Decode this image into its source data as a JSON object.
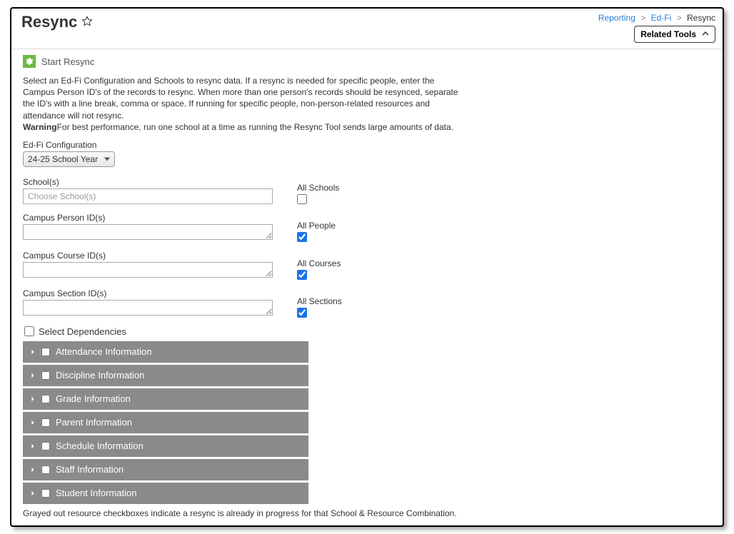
{
  "header": {
    "title": "Resync",
    "breadcrumb": {
      "reporting": "Reporting",
      "edfi": "Ed-Fi",
      "current": "Resync"
    },
    "related_tools_label": "Related Tools"
  },
  "start": {
    "label": "Start Resync"
  },
  "intro": {
    "text": "Select an Ed-Fi Configuration and Schools to resync data. If a resync is needed for specific people, enter the Campus Person ID's of the records to resync. When more than one person's records should be resynced, separate the ID's with a line break, comma or space. If running for specific people, non-person-related resources and attendance will not resync.",
    "warning_label": "Warning",
    "warning_text": "For best performance, run one school at a time as running the Resync Tool sends large amounts of data."
  },
  "config": {
    "label": "Ed-Fi Configuration",
    "selected": "24-25 School Year"
  },
  "schools": {
    "label": "School(s)",
    "placeholder": "Choose School(s)",
    "all_label": "All Schools",
    "all_checked": false
  },
  "person_ids": {
    "label": "Campus Person ID(s)",
    "all_label": "All People",
    "all_checked": true
  },
  "course_ids": {
    "label": "Campus Course ID(s)",
    "all_label": "All Courses",
    "all_checked": true
  },
  "section_ids": {
    "label": "Campus Section ID(s)",
    "all_label": "All Sections",
    "all_checked": true
  },
  "dependencies": {
    "select_label": "Select Dependencies"
  },
  "accordions": [
    {
      "label": "Attendance Information"
    },
    {
      "label": "Discipline Information"
    },
    {
      "label": "Grade Information"
    },
    {
      "label": "Parent Information"
    },
    {
      "label": "Schedule Information"
    },
    {
      "label": "Staff Information"
    },
    {
      "label": "Student Information"
    }
  ],
  "footnote": "Grayed out resource checkboxes indicate a resync is already in progress for that School & Resource Combination."
}
